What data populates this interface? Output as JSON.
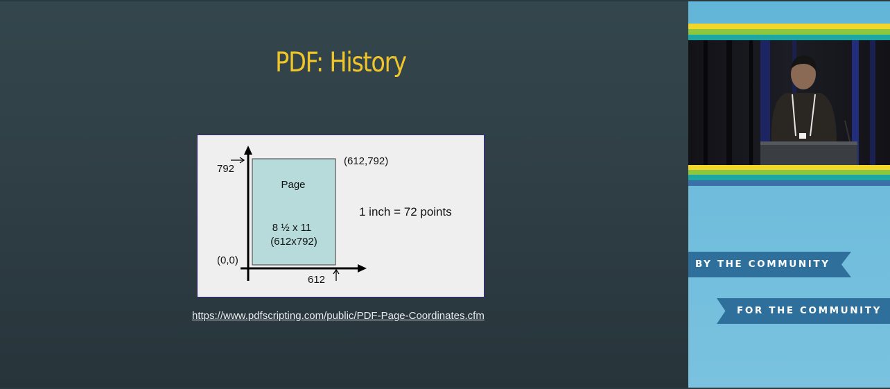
{
  "slide": {
    "title": "PDF: History",
    "figure": {
      "label_792": "792",
      "label_top_right": "(612,792)",
      "page_label": "Page",
      "page_size": "8 ½ x 11",
      "page_dims": "(612x792)",
      "origin_label": "(0,0)",
      "label_612": "612",
      "conversion": "1 inch = 72 points"
    },
    "source_url": "https://www.pdfscripting.com/public/PDF-Page-Coordinates.cfm"
  },
  "sidebar": {
    "banner_top": "BY THE COMMUNITY",
    "banner_bottom": "FOR THE COMMUNITY"
  },
  "colors": {
    "title": "#f0c52a",
    "slide_bg": "#2f3f45",
    "page_fill": "#b6dbda",
    "sidebar_bg": "#6fbcdc",
    "banner_bg": "#2f6f9b"
  }
}
